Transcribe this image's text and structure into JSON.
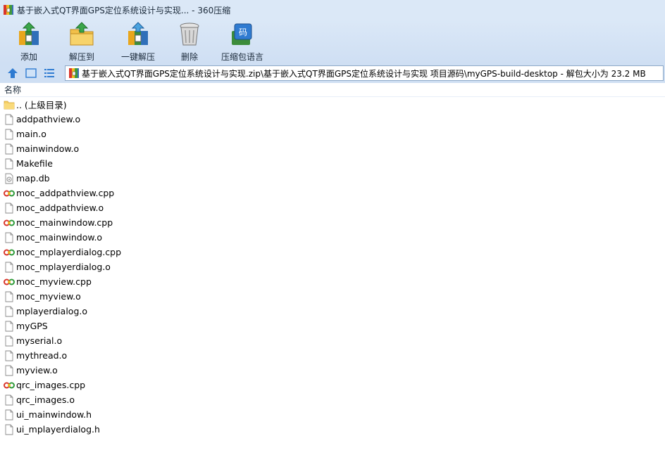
{
  "window": {
    "title": "基于嵌入式QT界面GPS定位系统设计与实现... - 360压缩"
  },
  "toolbar": {
    "buttons": [
      {
        "label": "添加",
        "icon": "add-archive-icon"
      },
      {
        "label": "解压到",
        "icon": "extract-to-icon"
      },
      {
        "label": "一键解压",
        "icon": "one-click-extract-icon"
      },
      {
        "label": "删除",
        "icon": "delete-trash-icon"
      },
      {
        "label": "压缩包语言",
        "icon": "archive-language-icon"
      }
    ]
  },
  "address": {
    "path": "基于嵌入式QT界面GPS定位系统设计与实现.zip\\基于嵌入式QT界面GPS定位系统设计与实现 项目源码\\myGPS-build-desktop - 解包大小为 23.2 MB"
  },
  "list": {
    "column_name": "名称",
    "items": [
      {
        "name": ".. (上级目录)",
        "icon": "folder-icon"
      },
      {
        "name": "addpathview.o",
        "icon": "file-icon"
      },
      {
        "name": "main.o",
        "icon": "file-icon"
      },
      {
        "name": "mainwindow.o",
        "icon": "file-icon"
      },
      {
        "name": "Makefile",
        "icon": "file-icon"
      },
      {
        "name": "map.db",
        "icon": "database-file-icon"
      },
      {
        "name": "moc_addpathview.cpp",
        "icon": "cpp-file-icon"
      },
      {
        "name": "moc_addpathview.o",
        "icon": "file-icon"
      },
      {
        "name": "moc_mainwindow.cpp",
        "icon": "cpp-file-icon"
      },
      {
        "name": "moc_mainwindow.o",
        "icon": "file-icon"
      },
      {
        "name": "moc_mplayerdialog.cpp",
        "icon": "cpp-file-icon"
      },
      {
        "name": "moc_mplayerdialog.o",
        "icon": "file-icon"
      },
      {
        "name": "moc_myview.cpp",
        "icon": "cpp-file-icon"
      },
      {
        "name": "moc_myview.o",
        "icon": "file-icon"
      },
      {
        "name": "mplayerdialog.o",
        "icon": "file-icon"
      },
      {
        "name": "myGPS",
        "icon": "file-icon"
      },
      {
        "name": "myserial.o",
        "icon": "file-icon"
      },
      {
        "name": "mythread.o",
        "icon": "file-icon"
      },
      {
        "name": "myview.o",
        "icon": "file-icon"
      },
      {
        "name": "qrc_images.cpp",
        "icon": "cpp-file-icon"
      },
      {
        "name": "qrc_images.o",
        "icon": "file-icon"
      },
      {
        "name": "ui_mainwindow.h",
        "icon": "file-icon"
      },
      {
        "name": "ui_mplayerdialog.h",
        "icon": "file-icon"
      }
    ]
  },
  "colors": {
    "titlebar_bg": "#dbe8f7",
    "toolbar_bg": "#cfdff3",
    "accent": "#2f7bd1"
  }
}
